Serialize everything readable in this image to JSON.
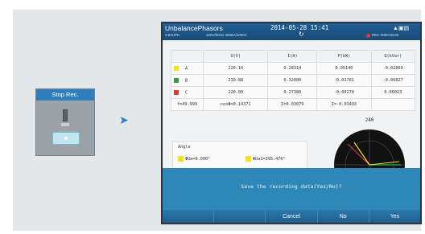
{
  "device": {
    "title": "Stop Rec."
  },
  "screen": {
    "title": "UnbalancePhasors",
    "datetime": "2014-05-28 15:41",
    "sub_left": "3,84UPH",
    "sub_mid": "220V/50Hz  3000A/1000V",
    "rec_text": "REC 0000:00:00",
    "refresh_icon": "↻",
    "status_icons": "▲▣▤",
    "table": {
      "headers": [
        "",
        "U(V)",
        "I(A)",
        "P(kW)",
        "Q(kVar)"
      ],
      "rows": [
        {
          "phase": "A",
          "color": "#f2e21b",
          "u": "220.10",
          "i": "0.28314",
          "p": "0.05140",
          "q": "-0.02869"
        },
        {
          "phase": "B",
          "color": "#2e9e3c",
          "u": "219.88",
          "i": "0.32080",
          "p": "-0.01781",
          "q": "-0.06827"
        },
        {
          "phase": "C",
          "color": "#e53935",
          "u": "220.08",
          "i": "0.27386",
          "p": "-0.00270",
          "q": "0.06023"
        }
      ],
      "summary": [
        "f=49.999",
        "cosΦ=0.14371",
        "Σ=0.03079",
        "Σ=-0.03493"
      ]
    },
    "angle": {
      "title": "Angle",
      "item1": "ΦUa=0.000°",
      "item2": "ΦUa1=395.476°"
    },
    "phasor_label": "240",
    "dialog_text": "Save the recording data(Yes/No)?",
    "buttons": [
      "",
      "",
      "Cancel",
      "No",
      "Yes"
    ]
  },
  "colors": {
    "accent": "#2f7fc0",
    "dialog": "#2d88b7",
    "titlebar": "#1f5e94"
  }
}
